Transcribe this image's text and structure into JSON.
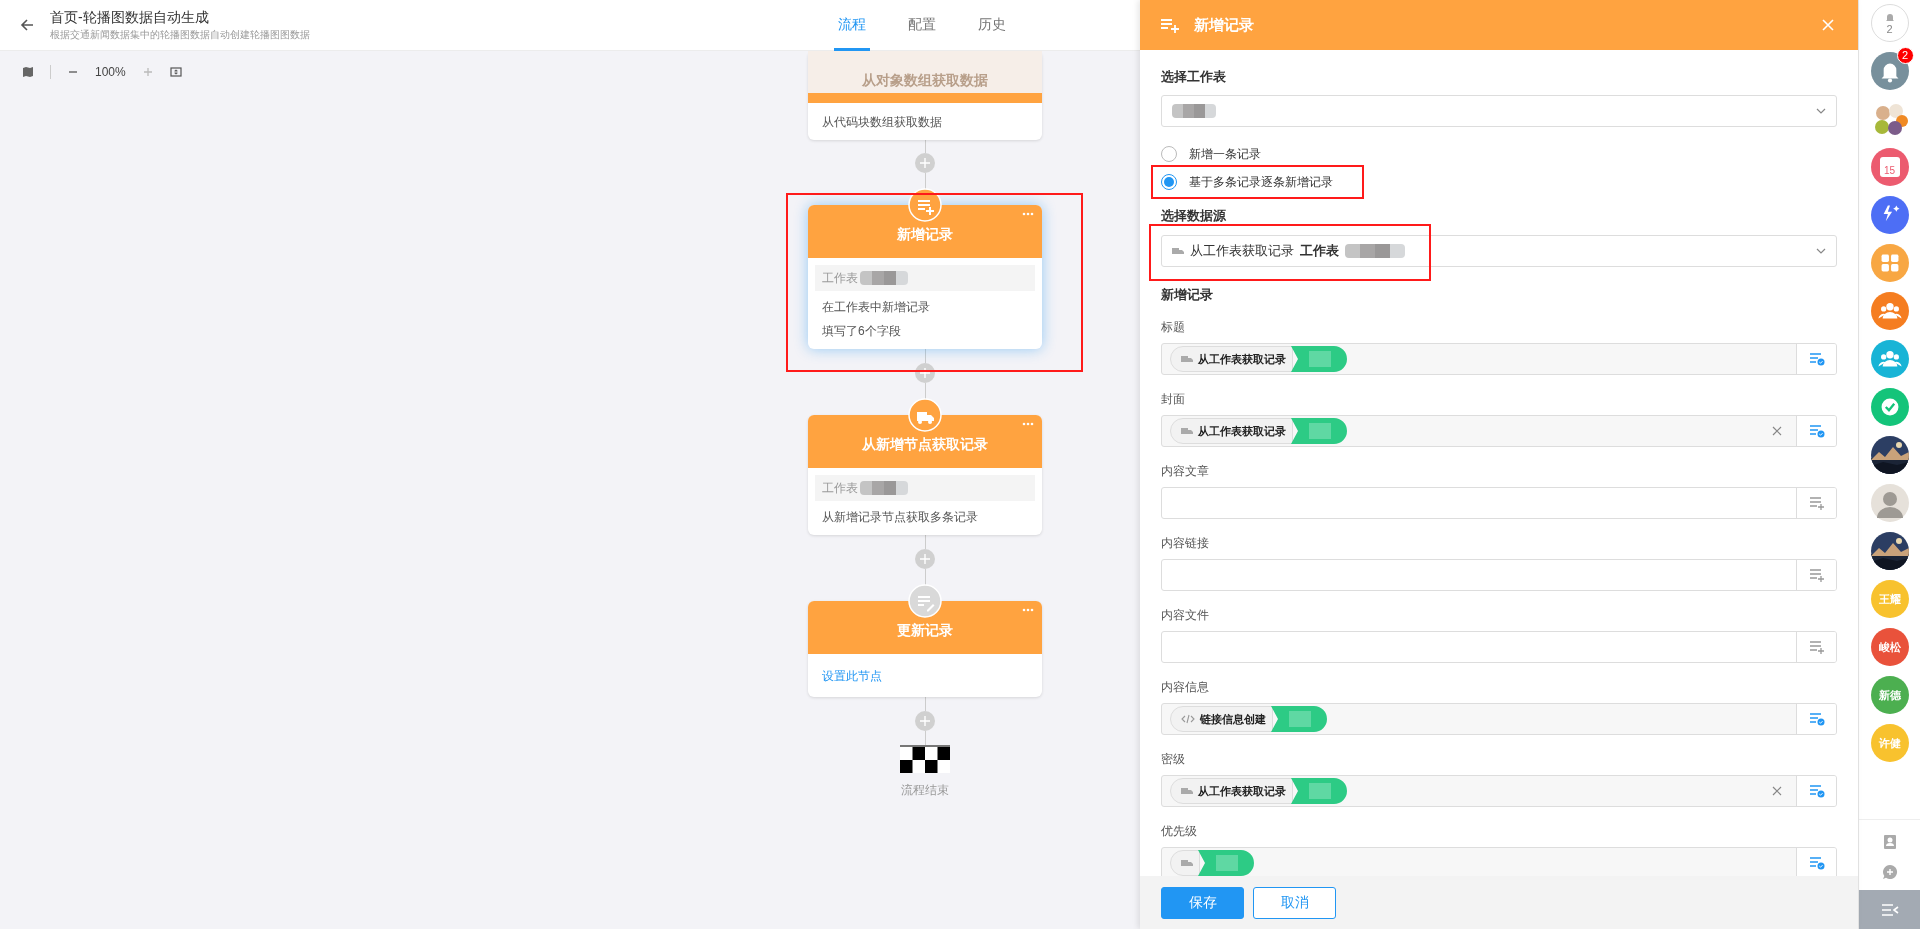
{
  "header": {
    "title": "首页-轮播图数据自动生成",
    "subtitle": "根据交通新闻数据集中的轮播图数据自动创建轮播图图数据",
    "tabs": [
      {
        "label": "流程",
        "selected": true
      },
      {
        "label": "配置",
        "selected": false
      },
      {
        "label": "历史",
        "selected": false
      }
    ]
  },
  "toolbar": {
    "zoom": "100%"
  },
  "flow": {
    "nodes": [
      {
        "faded": true,
        "title": "从对象数组获取数据",
        "selected": false,
        "lines": [
          {
            "kind": "plain",
            "text": "从代码块数组获取数据"
          }
        ]
      },
      {
        "kind": "add",
        "faded": false,
        "title": "新增记录",
        "selected": true,
        "configured": true,
        "table": "工作表",
        "lines": [
          {
            "kind": "plain",
            "text": "在工作表中新增记录"
          },
          {
            "kind": "plain",
            "text": "填写了6个字段"
          }
        ]
      },
      {
        "kind": "fetch",
        "faded": false,
        "title": "从新增节点获取记录",
        "selected": false,
        "configured": true,
        "table": "工作表",
        "lines": [
          {
            "kind": "plain",
            "text": "从新增记录节点获取多条记录"
          }
        ]
      },
      {
        "kind": "update",
        "faded": false,
        "title": "更新记录",
        "selected": false,
        "configured": false,
        "lines": [
          {
            "kind": "link",
            "text": "设置此节点"
          }
        ]
      }
    ],
    "end_label": "流程结束"
  },
  "panel": {
    "title": "新增记录",
    "worksheet_label": "选择工作表",
    "modes": [
      {
        "label": "新增一条记录",
        "selected": false
      },
      {
        "label": "基于多条记录逐条新增记录",
        "selected": true,
        "annotated": true
      }
    ],
    "source": {
      "label": "选择数据源",
      "node": "从工作表获取记录",
      "table": "工作表",
      "annotated": true
    },
    "fields_heading": "新增记录",
    "fields": [
      {
        "label": "标题",
        "tag": {
          "kind": "record",
          "text": "从工作表获取记录"
        }
      },
      {
        "label": "封面",
        "tag": {
          "kind": "record",
          "text": "从工作表获取记录"
        },
        "clearable": true
      },
      {
        "label": "内容文章"
      },
      {
        "label": "内容链接"
      },
      {
        "label": "内容文件"
      },
      {
        "label": "内容信息",
        "tag": {
          "kind": "code",
          "text": "链接信息创建"
        }
      },
      {
        "label": "密级",
        "tag": {
          "kind": "record",
          "text": "从工作表获取记录"
        },
        "clearable": true
      },
      {
        "label": "优先级",
        "tag": {
          "kind": "record"
        }
      }
    ],
    "buttons": [
      {
        "label": "保存",
        "kind": "primary"
      },
      {
        "label": "取消",
        "kind": "secondary"
      }
    ]
  },
  "sidebar": {
    "items": [
      {
        "kind": "bell-count",
        "text": "2"
      },
      {
        "kind": "bell",
        "badge": "2",
        "color": "#78909c"
      },
      {
        "kind": "group"
      },
      {
        "kind": "calendar",
        "text": "15",
        "color": "#ec5b6f"
      },
      {
        "kind": "sparkle",
        "color": "#4d6ef5"
      },
      {
        "kind": "grid",
        "color": "#f8a743"
      },
      {
        "kind": "people",
        "color": "#f57d20"
      },
      {
        "kind": "people",
        "color": "#18b4d6"
      },
      {
        "kind": "check",
        "color": "#14c47a"
      },
      {
        "kind": "picture"
      },
      {
        "kind": "person"
      },
      {
        "kind": "picture"
      },
      {
        "kind": "initials",
        "text": "王耀",
        "color": "#f8c22e"
      },
      {
        "kind": "initials",
        "text": "峻松",
        "color": "#e9523b"
      },
      {
        "kind": "initials",
        "text": "新德",
        "color": "#4caf50"
      },
      {
        "kind": "initials",
        "text": "许健",
        "color": "#f8c22e"
      }
    ]
  }
}
